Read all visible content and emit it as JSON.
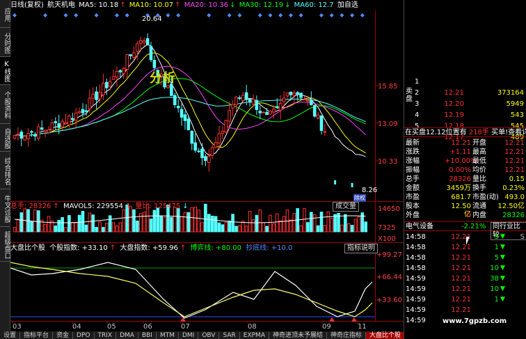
{
  "sidebar": {
    "tabs": [
      "应用",
      "分时图",
      "K线图",
      "个股资料",
      "自选股",
      "综合排名",
      "牛叉诊股",
      "超级盘口"
    ],
    "active": "K线图"
  },
  "header": {
    "period": "日线(复权)",
    "stock_name": "航天机电",
    "ma5": "MA5: 10.18",
    "ma10": "MA10: 10.07",
    "ma20": "MA20: 10.36",
    "ma30": "MA30: 12.19",
    "ma60": "MA60: 12.7",
    "add_watch": "加自选"
  },
  "price_chart": {
    "high_label": "20.64",
    "low_label": "8.26",
    "y_ticks": [
      "15.85",
      "13.09",
      "10.33"
    ],
    "overlay_text": "分析",
    "badge": "除权"
  },
  "volume_header": {
    "total": "总手: 28326",
    "mavol": "MAVOL5: 229554",
    "ratio": "量比: 125475",
    "button": "成交量"
  },
  "volume_y_ticks": [
    "14650",
    "7325",
    "X100"
  ],
  "indicator_header": {
    "name": "大盘比个股",
    "stock_index": "个股指数: +33.10",
    "market_index": "大盘指数: +59.96",
    "game_line": "博弈线: +80.00",
    "bottom_line": "抄底线: +10.0",
    "button": "指标说明"
  },
  "indicator_y_ticks": [
    "+99.27",
    "+66.44",
    "+33.60"
  ],
  "x_axis": [
    "03",
    "04",
    "05",
    "06",
    "07",
    "08",
    "09",
    "11"
  ],
  "bottom_tabs": [
    "设置",
    "指标平台",
    "资金",
    "DPO",
    "TRIX",
    "DMA",
    "BBI",
    "MTM",
    "DMI",
    "OBV",
    "SAR",
    "EXPMA",
    "神奇进顶未予展结",
    "神奇庄指标",
    "大盘比个股"
  ],
  "bottom_tab_active": "大盘比个股",
  "order_book": {
    "sell_label": "卖盘",
    "buy_label": "买盘",
    "rows": [
      {
        "n": "1",
        "p": "",
        "v": ""
      },
      {
        "n": "2",
        "p": "12.21",
        "v": "373164"
      },
      {
        "n": "3",
        "p": "12.20",
        "v": "5949"
      },
      {
        "n": "4",
        "p": "12.19",
        "v": "543"
      },
      {
        "n": "5",
        "p": "12.18",
        "v": "545"
      },
      {
        "n": "",
        "p": "12.17",
        "v": "489"
      }
    ],
    "status": "在买盘12.12位置有",
    "status_vol": "218手",
    "status_link": "买单!查看详细"
  },
  "quote": [
    {
      "l1": "最新",
      "v1": "12.21",
      "l2": "开盘",
      "v2": "12.21"
    },
    {
      "l1": "涨跌",
      "v1": "+1.11",
      "l2": "最高",
      "v2": "12.21"
    },
    {
      "l1": "涨幅",
      "v1": "+10.00%",
      "l2": "最低",
      "v2": "12.21"
    },
    {
      "l1": "振幅",
      "v1": "0.00%",
      "l2": "均价",
      "v2": "12.21"
    },
    {
      "l1": "总手",
      "v1": "28326",
      "l2": "量比",
      "v2": "0.15"
    },
    {
      "l1": "金额",
      "v1": "3459万",
      "l2": "换手",
      "v2": "0.23%"
    },
    {
      "l1": "市盈",
      "v1": "681.7",
      "l2": "市盈(动)",
      "v2": "493.0"
    },
    {
      "l1": "股本",
      "v1": "12.50亿",
      "l2": "流通",
      "v2": "12.50亿"
    },
    {
      "l1": "外盘",
      "v1": "0",
      "l2": "内盘",
      "v2": "28326"
    }
  ],
  "sector": {
    "name": "电气设备",
    "change": "-2.21%",
    "button": "同行业比较"
  },
  "ticks": [
    {
      "t": "14:58",
      "p": "12.21",
      "v": "5",
      "s": "S"
    },
    {
      "t": "14:58",
      "p": "12.21",
      "v": "1",
      "s": ""
    },
    {
      "t": "14:58",
      "p": "12.21",
      "v": "5",
      "s": ""
    },
    {
      "t": "14:58",
      "p": "12.21",
      "v": "10",
      "s": ""
    },
    {
      "t": "14:59",
      "p": "12.21",
      "v": "38",
      "s": ""
    },
    {
      "t": "14:59",
      "p": "12.21",
      "v": "10",
      "s": ""
    },
    {
      "t": "14:59",
      "p": "12.21",
      "v": "1",
      "s": ""
    },
    {
      "t": "14:59",
      "p": "12.21",
      "v": "",
      "s": ""
    },
    {
      "t": "14:59",
      "p": "",
      "v": "",
      "s": ""
    }
  ],
  "watermark": "www.7gpzb.com",
  "colors": {
    "up": "#ff3030",
    "down": "#55ffff",
    "ma5": "#ffffff",
    "ma10": "#ffff00",
    "ma20": "#ff44ff",
    "ma30": "#00ff00",
    "ma60": "#55ffff"
  }
}
